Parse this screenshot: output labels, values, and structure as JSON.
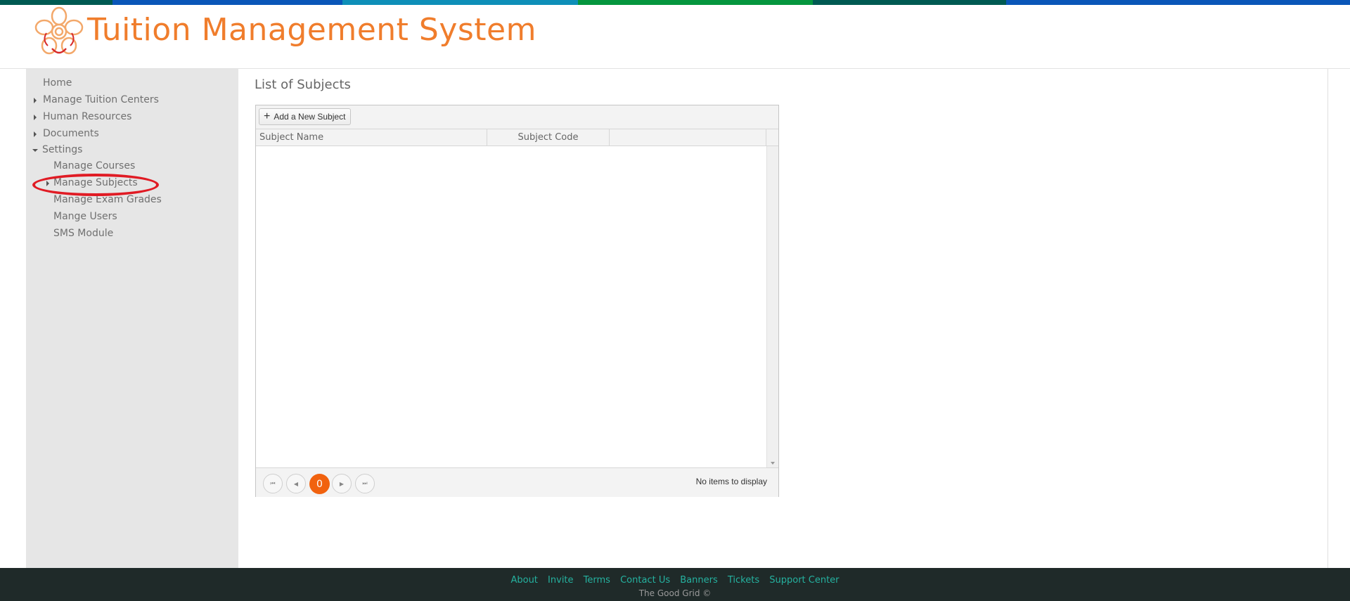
{
  "app": {
    "title": "Tuition Management System"
  },
  "colors": {
    "accent": "#f07d2c",
    "stripe": [
      "#005a52",
      "#0a56b8",
      "#0e8fb8",
      "#05963e",
      "#005a52",
      "#0a56b8"
    ]
  },
  "sidebar": {
    "items": [
      {
        "label": "Home",
        "caret": "none"
      },
      {
        "label": "Manage Tuition Centers",
        "caret": "right"
      },
      {
        "label": "Human Resources",
        "caret": "right"
      },
      {
        "label": "Documents",
        "caret": "right"
      },
      {
        "label": "Settings",
        "caret": "down"
      },
      {
        "label": "Manage Courses",
        "caret": "none"
      },
      {
        "label": "Manage Subjects",
        "caret": "right",
        "highlighted": true
      },
      {
        "label": "Manage Exam Grades",
        "caret": "none"
      },
      {
        "label": "Mange Users",
        "caret": "none"
      },
      {
        "label": "SMS Module",
        "caret": "none"
      }
    ]
  },
  "main": {
    "title": "List of Subjects",
    "grid": {
      "toolbar": {
        "add_label": "Add a New Subject",
        "add_icon": "plus-icon"
      },
      "columns": [
        "Subject Name",
        "Subject Code",
        ""
      ],
      "rows": [],
      "pager": {
        "current_page": "0",
        "info": "No items to display"
      }
    }
  },
  "footer": {
    "links": [
      "About",
      "Invite",
      "Terms",
      "Contact Us",
      "Banners",
      "Tickets",
      "Support Center"
    ],
    "copyright": "The Good Grid ©"
  }
}
